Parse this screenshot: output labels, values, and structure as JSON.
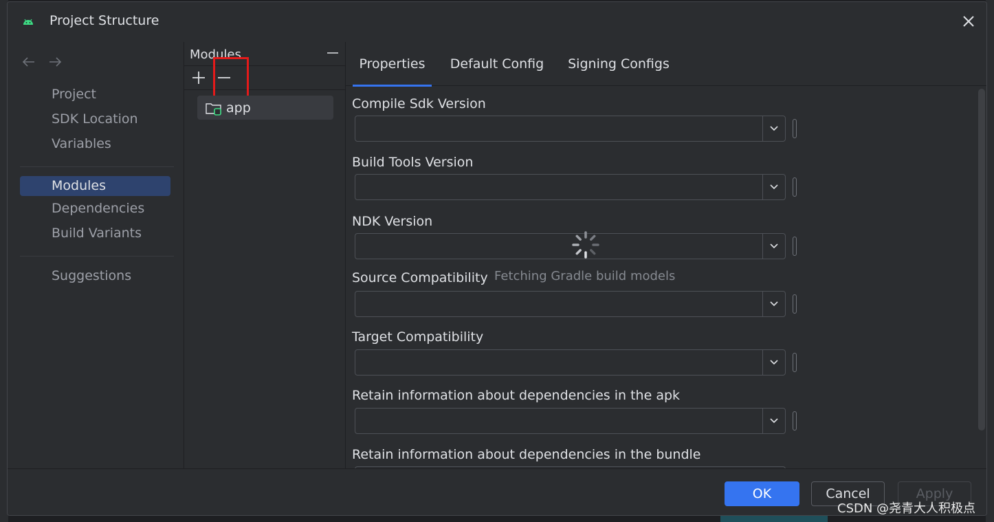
{
  "window": {
    "title": "Project Structure"
  },
  "nav": {
    "groups": [
      [
        {
          "label": "Project",
          "selected": false
        },
        {
          "label": "SDK Location",
          "selected": false
        },
        {
          "label": "Variables",
          "selected": false
        }
      ],
      [
        {
          "label": "Modules",
          "selected": true
        },
        {
          "label": "Dependencies",
          "selected": false
        },
        {
          "label": "Build Variants",
          "selected": false
        }
      ],
      [
        {
          "label": "Suggestions",
          "selected": false
        }
      ]
    ]
  },
  "modules": {
    "header": "Modules",
    "items": [
      {
        "label": "app",
        "selected": true
      }
    ]
  },
  "tabs": [
    {
      "label": "Properties",
      "active": true
    },
    {
      "label": "Default Config",
      "active": false
    },
    {
      "label": "Signing Configs",
      "active": false
    }
  ],
  "properties": {
    "fields": [
      {
        "label": "Compile Sdk Version",
        "value": ""
      },
      {
        "label": "Build Tools Version",
        "value": ""
      },
      {
        "label": "NDK Version",
        "value": ""
      },
      {
        "label": "Source Compatibility",
        "value": ""
      },
      {
        "label": "Target Compatibility",
        "value": ""
      },
      {
        "label": "Retain information about dependencies in the apk",
        "value": ""
      },
      {
        "label": "Retain information about dependencies in the bundle",
        "value": ""
      }
    ],
    "loading_text": "Fetching Gradle build models"
  },
  "footer": {
    "ok_label": "OK",
    "cancel_label": "Cancel",
    "apply_label": "Apply"
  },
  "watermark": "CSDN @尧青大人积极点",
  "colors": {
    "accent": "#3574f0",
    "highlight": "#e41a1a",
    "android_green": "#3ddc84"
  }
}
